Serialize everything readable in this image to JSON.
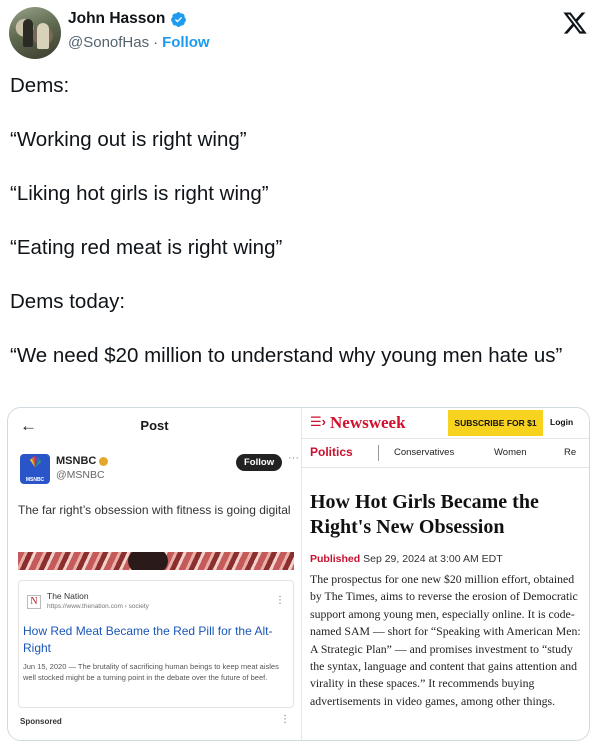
{
  "tweet": {
    "author_name": "John Hasson",
    "handle": "@SonofHas",
    "separator": "·",
    "follow_label": "Follow",
    "paragraphs": [
      "Dems:",
      "“Working out is right wing”",
      "“Liking hot girls is right wing”",
      "“Eating red meat is right wing”",
      "Dems today:",
      "“We need $20 million to understand why young men hate us”"
    ]
  },
  "left_post": {
    "title": "Post",
    "account_name": "MSNBC",
    "account_handle": "@MSNBC",
    "logo_tag": "MSNBC",
    "follow_label": "Follow",
    "text": "The far right’s obsession with fitness is going digital",
    "card": {
      "source_letter": "N",
      "source_name": "The Nation",
      "source_url": "https://www.thenation.com › society",
      "headline": "How Red Meat Became the Red Pill for the Alt-Right",
      "description": "Jun 15, 2020 — The brutality of sacrificing human beings to keep meat aisles well stocked might be a turning point in the debate over the future of beef."
    },
    "sponsored_label": "Sponsored"
  },
  "right_article": {
    "logo": "Newsweek",
    "subscribe_label": "SUBSCRIBE FOR $1",
    "login_label": "Login",
    "nav": [
      "Politics",
      "Conservatives",
      "Women",
      "Re"
    ],
    "headline": "How Hot Girls Became the Right's New Obsession",
    "published_label": "Published",
    "published_date": "Sep 29, 2024 at 3:00 AM EDT",
    "body": "The prospectus for one new $20 million effort, obtained by The Times, aims to reverse the erosion of Democratic support among young men, especially online. It is code-named SAM — short for “Speaking with American Men: A Strategic Plan” — and promises investment to “study the syntax, language and content that gains attention and virality in these spaces.” It recommends buying advertisements in video games, among other things."
  },
  "colors": {
    "link_blue": "#1d9bf0",
    "newsweek_red": "#d3102d",
    "subscribe_yellow": "#f7d320"
  }
}
